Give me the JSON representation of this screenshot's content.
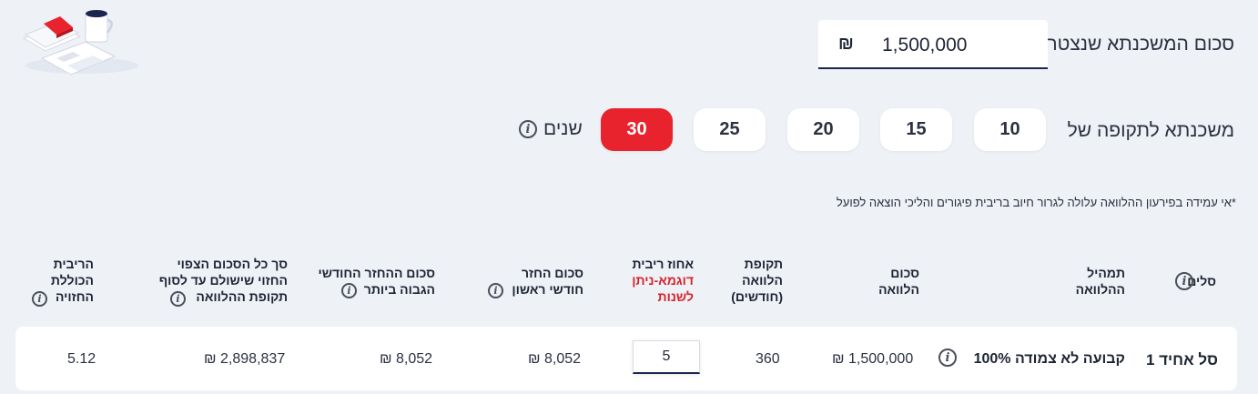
{
  "amount": {
    "label": "סכום המשכנתא שנצטרך",
    "value": "1,500,000",
    "currency": "₪"
  },
  "period": {
    "label": "משכנתא לתקופה של",
    "options": [
      "10",
      "15",
      "20",
      "25",
      "30"
    ],
    "selected": "30",
    "unit": "שנים"
  },
  "note": "*אי עמידה בפירעון ההלוואה עלולה לגרור חיוב בריבית פיגורים והליכי הוצאה לפועל",
  "table": {
    "headers": {
      "basket": "סלים",
      "mix_line1": "תמהיל",
      "mix_line2": "ההלוואה",
      "loan_line1": "סכום",
      "loan_line2": "הלוואה",
      "period_line1": "תקופת",
      "period_line2": "הלוואה",
      "period_line3": "(חודשים)",
      "rate_line1": "אחוז ריבית",
      "rate_line2": "דוגמא-ניתן",
      "rate_line3": "לשנות",
      "first_line1": "סכום החזר",
      "first_line2": "חודשי ראשון",
      "max_line1": "סכום ההחזר החודשי",
      "max_line2": "הגבוה ביותר",
      "total_line1": "סך כל הסכום הצפוי",
      "total_line2": "החזוי שישולם עד לסוף",
      "total_line3": "תקופת ההלוואה",
      "overall_line1": "הריבית",
      "overall_line2": "הכוללת",
      "overall_line3": "החזויה"
    },
    "row": {
      "basket": "סל אחיד 1",
      "mix": "100% קבועה לא צמודה",
      "loan_amount": "₪ 1,500,000",
      "months": "360",
      "rate": "5",
      "first_payment": "₪ 8,052",
      "max_payment": "₪ 8,052",
      "total": "₪ 2,898,837",
      "overall_rate": "5.12"
    }
  },
  "colors": {
    "accent": "#e8232d",
    "navy": "#1a2550",
    "background": "#eef1f6"
  }
}
